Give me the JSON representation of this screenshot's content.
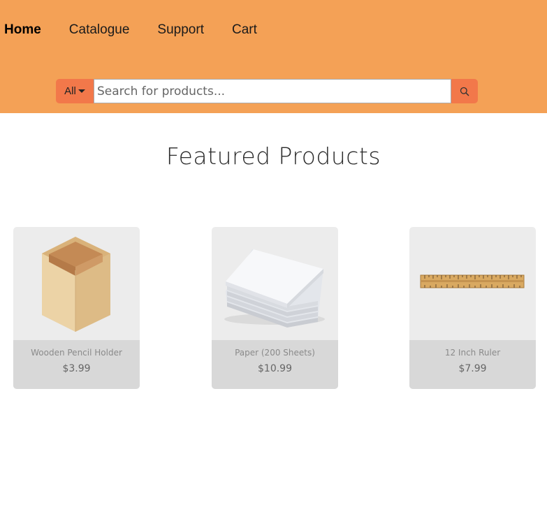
{
  "nav": {
    "items": [
      {
        "label": "Home",
        "active": true
      },
      {
        "label": "Catalogue",
        "active": false
      },
      {
        "label": "Support",
        "active": false
      },
      {
        "label": "Cart",
        "active": false
      }
    ]
  },
  "search": {
    "category": "All",
    "placeholder": "Search for products...",
    "value": ""
  },
  "section": {
    "title": "Featured Products"
  },
  "products": [
    {
      "name": "Wooden Pencil Holder",
      "price": "$3.99",
      "image": "wooden-pencil-holder"
    },
    {
      "name": "Paper (200 Sheets)",
      "price": "$10.99",
      "image": "paper-stack"
    },
    {
      "name": "12 Inch Ruler",
      "price": "$7.99",
      "image": "wooden-ruler"
    }
  ],
  "colors": {
    "header": "#f4a156",
    "accent": "#f2784a",
    "card": "#ececec",
    "card_footer": "#d8d8d8"
  }
}
